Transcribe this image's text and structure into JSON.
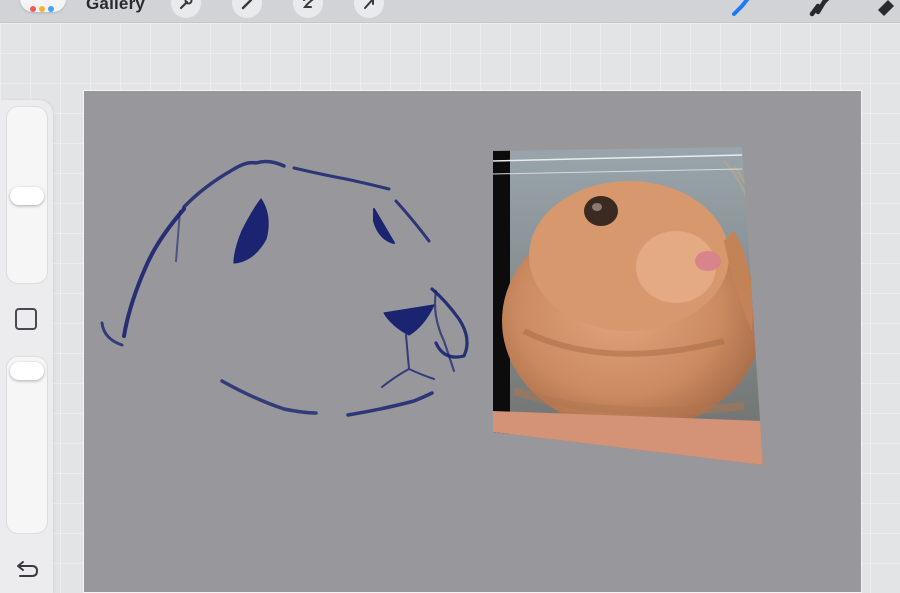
{
  "toolbar": {
    "gallery_label": "Gallery",
    "app_menu_dot_colors": [
      "#f25c54",
      "#f7b32b",
      "#3ea6ff"
    ],
    "tools_left": [
      "wrench-icon",
      "magic-wand-icon",
      "selection-icon",
      "transform-arrow-icon"
    ],
    "tools_right": [
      "brush-icon",
      "smudge-icon",
      "eraser-icon"
    ],
    "active_tool_color": "#1b7cf5"
  },
  "sidebar": {
    "size_slider_level": 0.5,
    "opacity_slider_level": 0.05,
    "controls": [
      "modify-button",
      "undo-button"
    ]
  },
  "canvas": {
    "background": "#98989c",
    "sketch_stroke_color": "#1a2470",
    "elements": [
      "bunny-sketch",
      "bunny-reference-photo"
    ]
  }
}
